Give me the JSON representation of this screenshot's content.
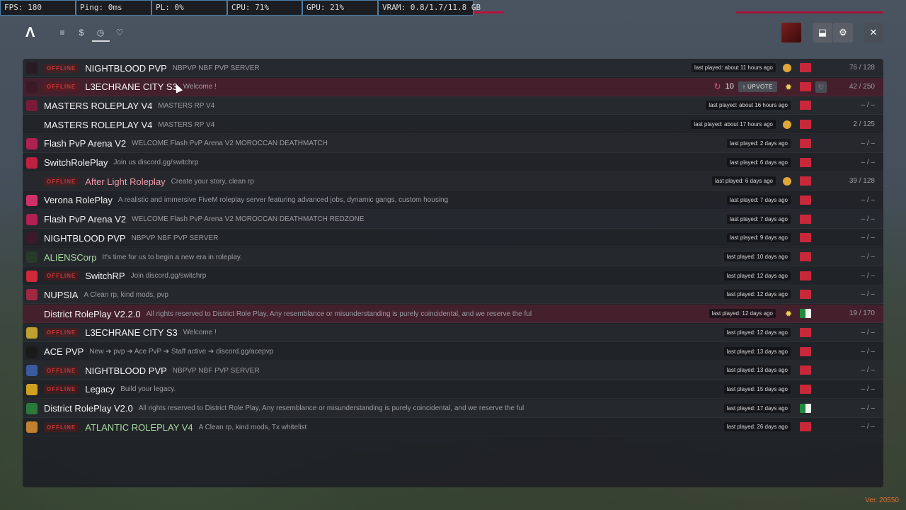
{
  "perf": [
    {
      "label": "FPS: 180"
    },
    {
      "label": "Ping: 0ms"
    },
    {
      "label": "PL: 0%"
    },
    {
      "label": "CPU: 71%"
    },
    {
      "label": "GPU: 21%"
    },
    {
      "label": "VRAM: 0.8/1.7/11.8 GB"
    }
  ],
  "header": {
    "logo": "Λ",
    "nav": [
      {
        "icon": "list-icon",
        "glyph": "≡"
      },
      {
        "icon": "dollar-icon",
        "glyph": "$"
      },
      {
        "icon": "clock-icon",
        "glyph": "◷"
      },
      {
        "icon": "heart-icon",
        "glyph": "♡"
      }
    ],
    "buttons": {
      "downloads": "⬓",
      "settings": "⚙",
      "close": "✕"
    }
  },
  "servers": [
    {
      "offline": true,
      "name": "NIGHTBLOOD PVP",
      "desc": "NBPVP NBF PVP SERVER",
      "last": "last played: about 11 hours ago",
      "badge": "boost",
      "flag": "red",
      "players": "76 / 128",
      "icon_color": "#2a1a22"
    },
    {
      "offline": true,
      "name": "L3ECHRANE CITY S3",
      "desc": "Welcome !",
      "upvotes": "10",
      "upvote_label": "UPVOTE",
      "badge": "sun",
      "flag": "red",
      "players": "42 / 250",
      "highlight": true,
      "heart": "♡",
      "icon_color": "#3a1a24"
    },
    {
      "offline": false,
      "name": "MASTERS ROLEPLAY V4",
      "desc": "MASTERS RP V4",
      "last": "last played: about 16 hours ago",
      "badge": "",
      "flag": "red",
      "players": "– / –",
      "icon_color": "#7a1a3a"
    },
    {
      "offline": false,
      "name": "MASTERS ROLEPLAY V4",
      "desc": "MASTERS RP V4",
      "last": "last played: about 17 hours ago",
      "badge": "boost",
      "flag": "red",
      "players": "2 / 125",
      "icon_color": "transparent"
    },
    {
      "offline": false,
      "name": "Flash PvP Arena V2",
      "desc": "WELCOME Flash PvP Arena V2 MOROCCAN DEATHMATCH",
      "last": "last played: 2 days ago",
      "badge": "",
      "flag": "red",
      "players": "– / –",
      "icon_color": "#b02050"
    },
    {
      "offline": false,
      "name": "SwitchRolePlay",
      "desc": "Join us discord.gg/switchrp",
      "last": "last played: 6 days ago",
      "badge": "",
      "flag": "red",
      "players": "– / –",
      "icon_color": "#c02040"
    },
    {
      "offline": true,
      "name": "After Light Roleplay",
      "desc": "Create your story, clean rp",
      "last": "last played: 6 days ago",
      "badge": "boost",
      "flag": "red",
      "players": "39 / 128",
      "name_color": "pink",
      "icon_color": "transparent"
    },
    {
      "offline": false,
      "name": "Verona RolePlay",
      "desc": "A realistic and immersive FiveM roleplay server featuring advanced jobs, dynamic gangs, custom housing",
      "last": "last played: 7 days ago",
      "badge": "",
      "flag": "red",
      "players": "– / –",
      "icon_color": "#d0306a"
    },
    {
      "offline": false,
      "name": "Flash PvP Arena V2",
      "desc": "WELCOME Flash PvP Arena V2 MOROCCAN DEATHMATCH REDZONE",
      "last": "last played: 7 days ago",
      "badge": "",
      "flag": "red",
      "players": "– / –",
      "icon_color": "#b02050"
    },
    {
      "offline": false,
      "name": "NIGHTBLOOD PVP",
      "desc": "NBPVP NBF PVP SERVER",
      "last": "last played: 9 days ago",
      "badge": "",
      "flag": "red",
      "players": "– / –",
      "icon_color": "#3a1a28"
    },
    {
      "offline": false,
      "name": "ALIENSCorp",
      "desc": "It's time for us to begin a new era in roleplay.",
      "last": "last played: 10 days ago",
      "badge": "",
      "flag": "red",
      "players": "– / –",
      "name_color": "green",
      "icon_color": "#2a3a2a"
    },
    {
      "offline": true,
      "name": "SwitchRP",
      "desc": "Join discord.gg/switchrp",
      "last": "last played: 12 days ago",
      "badge": "",
      "flag": "red",
      "players": "– / –",
      "icon_color": "#d02a3a"
    },
    {
      "offline": false,
      "name": "NUPSIA",
      "desc": "A Clean rp, kind mods, pvp",
      "last": "last played: 12 days ago",
      "badge": "",
      "flag": "red",
      "players": "– / –",
      "icon_color": "#a02840"
    },
    {
      "offline": false,
      "name": "District RolePlay V2.2.0",
      "desc": "All rights reserved to District Role Play, Any resemblance or misunderstanding is purely coincidental, and we reserve the ful",
      "last": "last played: 12 days ago",
      "badge": "sun",
      "flag": "dz",
      "players": "19 / 170",
      "highlight": true,
      "icon_color": "transparent"
    },
    {
      "offline": true,
      "name": "L3ECHRANE CITY S3",
      "desc": "Welcome !",
      "last": "last played: 12 days ago",
      "badge": "",
      "flag": "red",
      "players": "– / –",
      "icon_color": "#c0a030"
    },
    {
      "offline": false,
      "name": "ACE PVP",
      "desc": "New ➔ pvp ➔ Ace PvP ➔ Staff active ➔ discord.gg/acepvp",
      "last": "last played: 13 days ago",
      "badge": "",
      "flag": "red",
      "players": "– / –",
      "icon_color": "#1a1a1a"
    },
    {
      "offline": true,
      "name": "NIGHTBLOOD PVP",
      "desc": "NBPVP NBF PVP SERVER",
      "last": "last played: 13 days ago",
      "badge": "",
      "flag": "red",
      "players": "– / –",
      "icon_color": "#3a5aa0"
    },
    {
      "offline": true,
      "name": "Legacy",
      "desc": "Build your legacy.",
      "last": "last played: 15 days ago",
      "badge": "",
      "flag": "red",
      "players": "– / –",
      "icon_color": "#d0a020"
    },
    {
      "offline": false,
      "name": "District RolePlay V2.0",
      "desc": "All rights reserved to District Role Play, Any resemblance or misunderstanding is purely coincidental, and we reserve the ful",
      "last": "last played: 17 days ago",
      "badge": "",
      "flag": "dz",
      "players": "– / –",
      "icon_color": "#2a7a3a"
    },
    {
      "offline": true,
      "name": "ATLANTIC ROLEPLAY V4",
      "desc": "A Clean rp, kind mods, Tx whitelist",
      "last": "last played: 26 days ago",
      "badge": "",
      "flag": "red",
      "players": "– / –",
      "name_color": "green",
      "icon_color": "#c08030"
    }
  ],
  "offline_label": "OFFLINE",
  "version": "Ver. 20550"
}
